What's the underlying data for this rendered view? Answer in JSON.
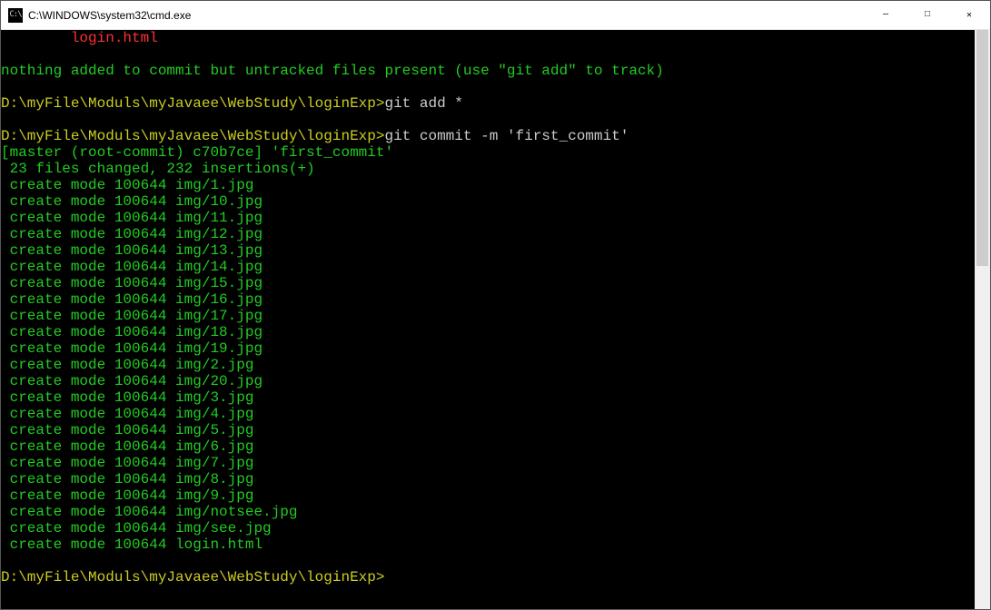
{
  "titlebar": {
    "icon_text": "C:\\",
    "title": "C:\\WINDOWS\\system32\\cmd.exe",
    "min": "—",
    "max": "□",
    "close": "✕"
  },
  "terminal": {
    "red_line": "        login.html",
    "blank": "",
    "nothing_line": "nothing added to commit but untracked files present (use \"git add\" to track)",
    "prompt1_path": "D:\\myFile\\Moduls\\myJavaee\\WebStudy\\loginExp>",
    "cmd1": "git add *",
    "prompt2_path": "D:\\myFile\\Moduls\\myJavaee\\WebStudy\\loginExp>",
    "cmd2": "git commit -m 'first_commit'",
    "out": [
      "[master (root-commit) c70b7ce] 'first_commit'",
      " 23 files changed, 232 insertions(+)",
      " create mode 100644 img/1.jpg",
      " create mode 100644 img/10.jpg",
      " create mode 100644 img/11.jpg",
      " create mode 100644 img/12.jpg",
      " create mode 100644 img/13.jpg",
      " create mode 100644 img/14.jpg",
      " create mode 100644 img/15.jpg",
      " create mode 100644 img/16.jpg",
      " create mode 100644 img/17.jpg",
      " create mode 100644 img/18.jpg",
      " create mode 100644 img/19.jpg",
      " create mode 100644 img/2.jpg",
      " create mode 100644 img/20.jpg",
      " create mode 100644 img/3.jpg",
      " create mode 100644 img/4.jpg",
      " create mode 100644 img/5.jpg",
      " create mode 100644 img/6.jpg",
      " create mode 100644 img/7.jpg",
      " create mode 100644 img/8.jpg",
      " create mode 100644 img/9.jpg",
      " create mode 100644 img/notsee.jpg",
      " create mode 100644 img/see.jpg",
      " create mode 100644 login.html"
    ],
    "prompt3_path": "D:\\myFile\\Moduls\\myJavaee\\WebStudy\\loginExp>"
  }
}
